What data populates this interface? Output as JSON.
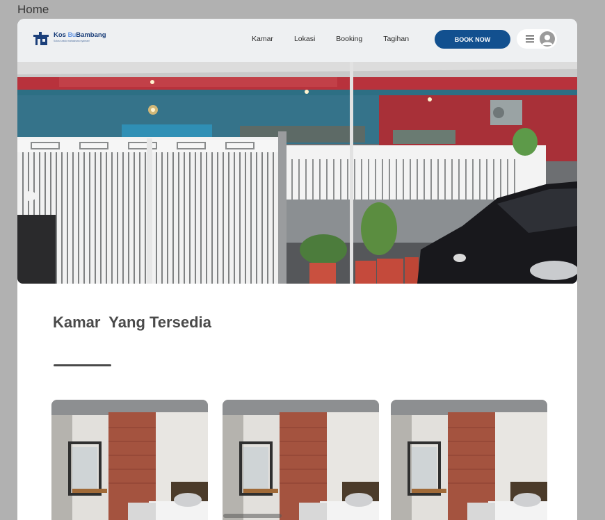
{
  "page": {
    "label": "Home"
  },
  "brand": {
    "name_part1": "Kos ",
    "name_part2": "Bu",
    "name_part3": "Bambang",
    "tagline": "Solusi untuk mahasiswa nyaman!"
  },
  "nav": {
    "items": [
      {
        "label": "Kamar"
      },
      {
        "label": "Lokasi"
      },
      {
        "label": "Booking"
      },
      {
        "label": "Tagihan"
      }
    ],
    "cta_label": "BOOK NOW",
    "menu_icon": "hamburger-icon",
    "avatar_icon": "user-avatar-icon"
  },
  "hero": {
    "image": "boarding-house-front-photo"
  },
  "section": {
    "title": "Kamar  Yang Tersedia"
  },
  "rooms": [
    {
      "image": "room-photo"
    },
    {
      "image": "room-photo"
    },
    {
      "image": "room-photo"
    }
  ],
  "colors": {
    "primary": "#12508f",
    "navbar_bg": "#eef0f2",
    "outer_bg": "#b1b1b1",
    "heading": "#4a4a4a"
  }
}
